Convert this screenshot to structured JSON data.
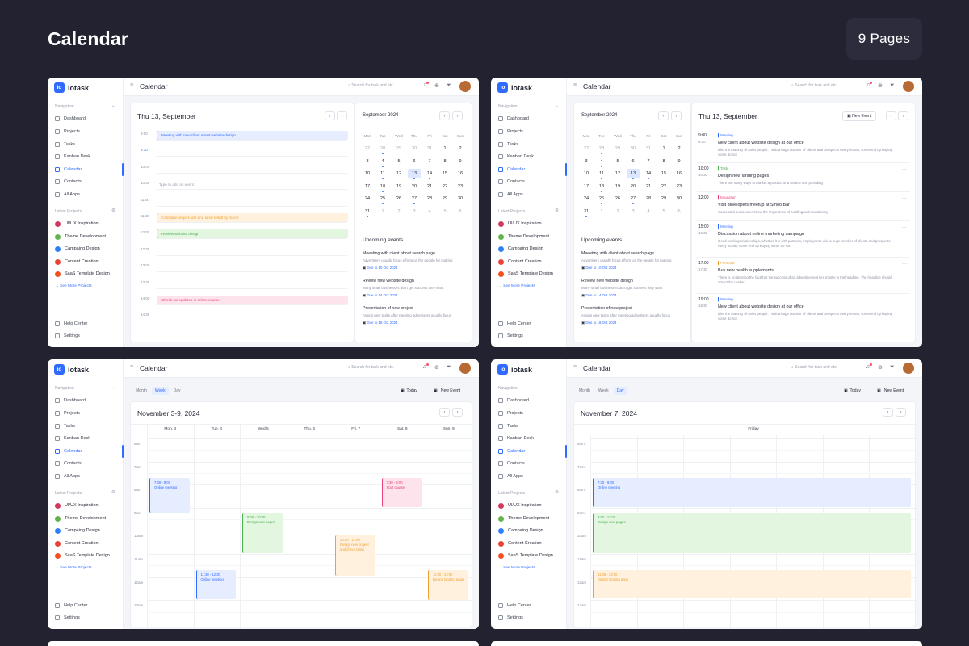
{
  "page": {
    "title": "Calendar",
    "badge": "9 Pages"
  },
  "app": {
    "logo_mark": "io",
    "name": "iotask",
    "page_title": "Calendar",
    "search_placeholder": "Search for task and etc."
  },
  "sidebar": {
    "nav_label": "Navigation",
    "nav_items": [
      {
        "label": "Dashboard"
      },
      {
        "label": "Projects"
      },
      {
        "label": "Tasks"
      },
      {
        "label": "Kanban Desk"
      },
      {
        "label": "Calendar"
      },
      {
        "label": "Contacts"
      },
      {
        "label": "All Apps"
      }
    ],
    "projects_label": "Latest Projects",
    "projects": [
      {
        "label": "UI/UX Inspiration",
        "color": "#d4375c"
      },
      {
        "label": "Theme Development",
        "color": "#62b34b"
      },
      {
        "label": "Campaing Design",
        "color": "#2d7ff9"
      },
      {
        "label": "Content Creation",
        "color": "#ea4335"
      },
      {
        "label": "SaaS Template Design",
        "color": "#f24e1e"
      }
    ],
    "see_more": "See More Projects",
    "help": "Help Center",
    "settings": "Settings"
  },
  "day_view": {
    "title": "Thu 13, September",
    "times": [
      "9:00",
      "9:30",
      "10:00",
      "10:30",
      "11:00",
      "11:30",
      "12:00",
      "12:30",
      "13:00",
      "13:30",
      "14:00",
      "14:30"
    ],
    "events": [
      {
        "text": "Meeting with new client about website design",
        "color": "#2f6bff",
        "bg": "#e6edff"
      },
      {
        "text": "Type to add an event",
        "color": "#9aa0ad",
        "bg": "#ffffff"
      },
      {
        "text": "Calculate project rate and send result by report",
        "color": "#f0a030",
        "bg": "#fff1dd"
      },
      {
        "text": "Review website design",
        "color": "#4caf50",
        "bg": "#e3f6e0"
      },
      {
        "text": "Check out updates in online course",
        "color": "#e8427a",
        "bg": "#fde3ec"
      }
    ]
  },
  "mini_calendar": {
    "month": "September 2024",
    "weekdays": [
      "Mon",
      "Tue",
      "Wed",
      "Thu",
      "Fri",
      "Sat",
      "Sun"
    ],
    "weeks": [
      [
        "27",
        "28",
        "29",
        "30",
        "31",
        "1",
        "2"
      ],
      [
        "3",
        "4",
        "5",
        "6",
        "7",
        "8",
        "9"
      ],
      [
        "10",
        "11",
        "12",
        "13",
        "14",
        "15",
        "16"
      ],
      [
        "17",
        "18",
        "19",
        "20",
        "21",
        "22",
        "23"
      ],
      [
        "24",
        "25",
        "26",
        "27",
        "28",
        "29",
        "30"
      ],
      [
        "31",
        "1",
        "2",
        "3",
        "4",
        "5",
        "6"
      ]
    ]
  },
  "upcoming": {
    "title": "Upcoming events",
    "due_label": "Due to",
    "events": [
      {
        "title": "Meeeting with client about search page",
        "desc": "Advertisers usually focus efforts on the people for making",
        "due": "10 Oct 2024"
      },
      {
        "title": "Review new website design",
        "desc": "Many small businesses don't get success they want",
        "due": "14 Oct 2024"
      },
      {
        "title": "Presentation of new project",
        "desc": "Assign new tasks after meeting advertisers usually focus",
        "due": "18 Oct 2024"
      }
    ]
  },
  "agenda": {
    "new_event": "New Event",
    "items": [
      {
        "start": "9:00",
        "end": "9:30",
        "category": "Meeting",
        "cat_color": "#2f6bff",
        "title": "New client about website design at our office",
        "desc": "Like the majority of sales people, I visit a huge number of clients and prospects every month, some end up buying some do not"
      },
      {
        "start": "10:00",
        "end": "10:30",
        "category": "Task",
        "cat_color": "#4caf50",
        "title": "Design new landing pages",
        "desc": "There are many ways to market a product or a service and providing"
      },
      {
        "start": "12:00",
        "end": "",
        "category": "Education",
        "cat_color": "#e8427a",
        "title": "Visit developers meetup at Smoo Bar",
        "desc": "Successful businesses know the importance of building and maintaining"
      },
      {
        "start": "15:00",
        "end": "15:30",
        "category": "Meeting",
        "cat_color": "#2f6bff",
        "title": "Discussion about online marketing campaign",
        "desc": "Good working relationships, whether it is with partners, employees I visit a huge number of clients and prospects every month, some end up buying some do not"
      },
      {
        "start": "17:00",
        "end": "17:30",
        "category": "Personal",
        "cat_color": "#f0a030",
        "title": "Buy new health supplements",
        "desc": "There is no denying the fact that the success of an advertisement lies mostly in the headline. The headline should attract the reader"
      },
      {
        "start": "19:00",
        "end": "19:30",
        "category": "Meeting",
        "cat_color": "#2f6bff",
        "title": "New client about website design at our office",
        "desc": "Like the majority of sales people, I visit a huge number of clients and prospects every month, some end up buying some do not"
      }
    ]
  },
  "view_switch": {
    "month": "Month",
    "week": "Week",
    "day": "Day",
    "today": "Today",
    "new_event": "New Event"
  },
  "week_view": {
    "title": "November 3-9, 2024",
    "days": [
      "Mon, 3",
      "Tue, 4",
      "Wed.5",
      "Thu, 6",
      "Fri, 7",
      "Sat, 8",
      "Sun, 9"
    ],
    "hours": [
      "6am",
      "7am",
      "8am",
      "9am",
      "10am",
      "11am",
      "12am",
      "13am"
    ],
    "events": [
      {
        "time": "7:30 - 9:00",
        "title": "Online meeting",
        "color": "#2f6bff",
        "bg": "#e6edff"
      },
      {
        "time": "11:30 - 12:30",
        "title": "Online meeting",
        "color": "#2f6bff",
        "bg": "#e6edff"
      },
      {
        "time": "9:00 - 10:00",
        "title": "Design new pages",
        "color": "#4caf50",
        "bg": "#e3f6e0"
      },
      {
        "time": "10:00 - 12:00",
        "title": "Design new project and check tasks",
        "color": "#f0a030",
        "bg": "#fff1dd"
      },
      {
        "time": "7:30 - 9:00",
        "title": "Start course",
        "color": "#e8427a",
        "bg": "#fde3ec"
      },
      {
        "time": "11:30 - 13:00",
        "title": "Design landing page",
        "color": "#f0a030",
        "bg": "#fff1dd"
      }
    ]
  },
  "single_day_view": {
    "title": "November 7, 2024",
    "weekday": "Friday",
    "hours": [
      "6am",
      "7am",
      "8am",
      "9am",
      "10am",
      "11am",
      "12am",
      "13am"
    ],
    "events": [
      {
        "time": "7:30 - 9:00",
        "title": "Online meeting",
        "color": "#2f6bff",
        "bg": "#e6edff"
      },
      {
        "time": "9:00 - 11:00",
        "title": "Design new pages",
        "color": "#4caf50",
        "bg": "#e3f6e0"
      },
      {
        "time": "11:30 - 13:00",
        "title": "Design landing page",
        "color": "#f0a030",
        "bg": "#fff1dd"
      }
    ]
  }
}
